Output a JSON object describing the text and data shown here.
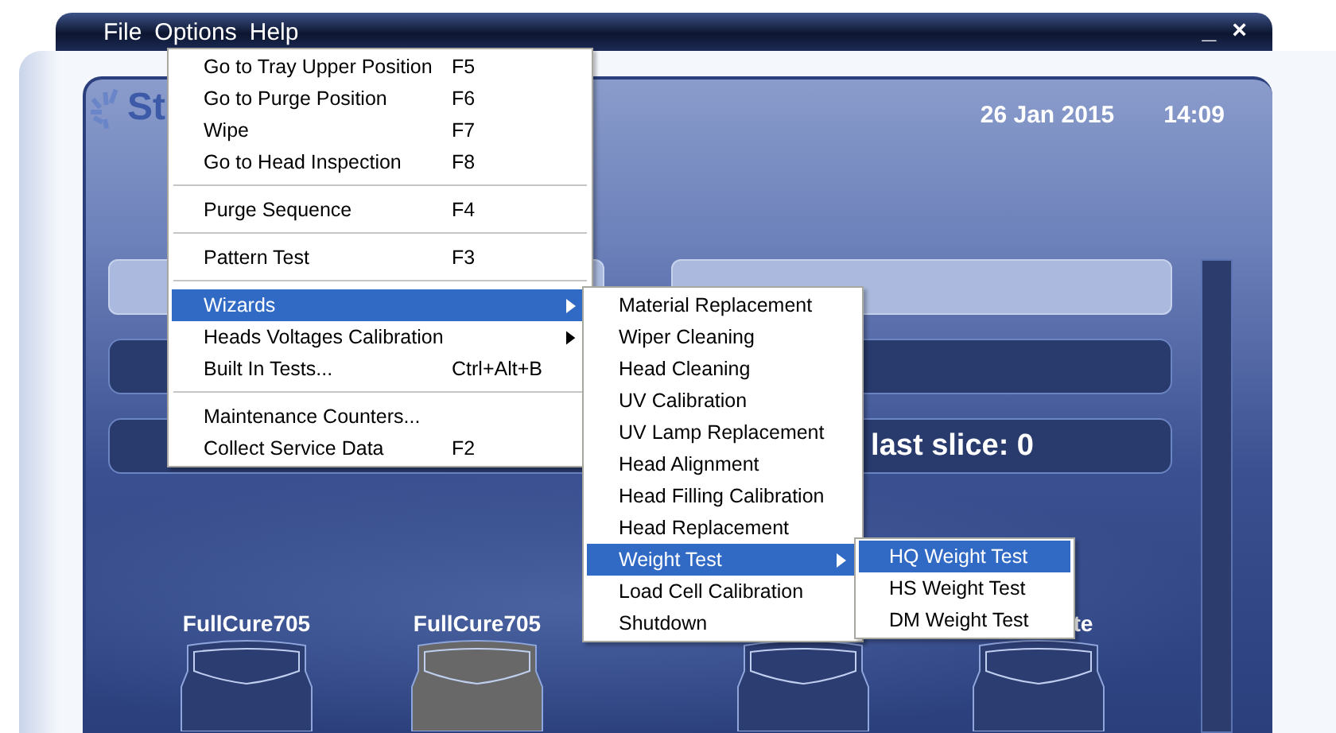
{
  "window": {
    "controls": [
      "_",
      "×"
    ]
  },
  "menu_bar": [
    {
      "label": "File"
    },
    {
      "label": "Options"
    },
    {
      "label": "Help"
    }
  ],
  "header": {
    "logo": "St",
    "date": "26 Jan 2015",
    "time": "14:09"
  },
  "status_line": "last slice: 0",
  "cartridges": [
    {
      "label": "FullCure705",
      "color": "#2c3d72"
    },
    {
      "label": "FullCure705",
      "color": "#686868"
    },
    {
      "color": "#2c3d72"
    },
    {
      "label": "te",
      "color": "#2c3d72"
    }
  ],
  "options_menu": {
    "groups": [
      [
        {
          "label": "Go to Tray Upper Position",
          "shortcut": "F5",
          "submenu": false,
          "selected": false
        },
        {
          "label": "Go to Purge Position",
          "shortcut": "F6",
          "submenu": false,
          "selected": false
        },
        {
          "label": "Wipe",
          "shortcut": "F7",
          "submenu": false,
          "selected": false
        },
        {
          "label": "Go to Head Inspection",
          "shortcut": "F8",
          "submenu": false,
          "selected": false
        }
      ],
      [
        {
          "label": "Purge Sequence",
          "shortcut": "F4",
          "submenu": false,
          "selected": false
        }
      ],
      [
        {
          "label": "Pattern Test",
          "shortcut": "F3",
          "submenu": false,
          "selected": false
        }
      ],
      [
        {
          "label": "Wizards",
          "submenu": true,
          "selected": true
        },
        {
          "label": "Heads Voltages Calibration",
          "submenu": true,
          "selected": false
        },
        {
          "label": "Built In Tests...",
          "shortcut": "Ctrl+Alt+B",
          "submenu": false,
          "selected": false
        }
      ],
      [
        {
          "label": "Maintenance Counters...",
          "submenu": false,
          "selected": false
        },
        {
          "label": "Collect Service Data",
          "shortcut": "F2",
          "submenu": false,
          "selected": false
        }
      ]
    ]
  },
  "wizards_menu": {
    "items": [
      {
        "label": "Material Replacement",
        "submenu": false,
        "selected": false
      },
      {
        "label": "Wiper Cleaning",
        "submenu": false,
        "selected": false
      },
      {
        "label": "Head Cleaning",
        "submenu": false,
        "selected": false
      },
      {
        "label": "UV Calibration",
        "submenu": false,
        "selected": false
      },
      {
        "label": "UV Lamp Replacement",
        "submenu": false,
        "selected": false
      },
      {
        "label": "Head Alignment",
        "submenu": false,
        "selected": false
      },
      {
        "label": "Head Filling Calibration",
        "submenu": false,
        "selected": false
      },
      {
        "label": "Head Replacement",
        "submenu": false,
        "selected": false
      },
      {
        "label": "Weight Test",
        "submenu": true,
        "selected": true
      },
      {
        "label": "Load Cell Calibration",
        "submenu": false,
        "selected": false
      },
      {
        "label": "Shutdown",
        "submenu": false,
        "selected": false
      }
    ]
  },
  "weight_test_menu": {
    "items": [
      {
        "label": "HQ Weight Test",
        "selected": true
      },
      {
        "label": "HS Weight Test",
        "selected": false
      },
      {
        "label": "DM Weight Test",
        "selected": false
      }
    ]
  }
}
